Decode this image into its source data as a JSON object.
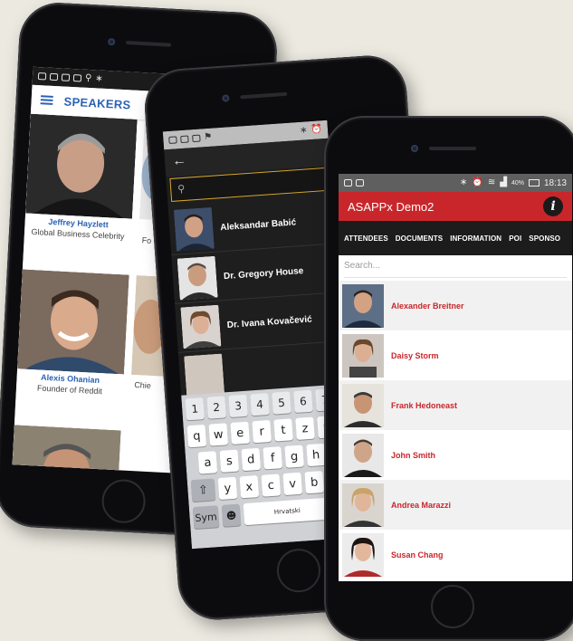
{
  "phone1": {
    "header_title": "SPEAKERS",
    "speakers": [
      {
        "name": "Jeffrey Hayzlett",
        "role": "Global Business Celebrity"
      },
      {
        "name": "",
        "role": "Fo"
      },
      {
        "name": "Alexis Ohanian",
        "role": "Founder of Reddit"
      },
      {
        "name": "",
        "role": "Chie"
      },
      {
        "name": "",
        "role": ""
      }
    ]
  },
  "phone2": {
    "contacts": [
      {
        "name": "Aleksandar Babić"
      },
      {
        "name": "Dr. Gregory House"
      },
      {
        "name": "Dr. Ivana Kovačević"
      }
    ],
    "keyboard": {
      "numbers": [
        "1",
        "2",
        "3",
        "4",
        "5",
        "6",
        "7"
      ],
      "row1": [
        "q",
        "w",
        "e",
        "r",
        "t",
        "z",
        "u"
      ],
      "row2": [
        "a",
        "s",
        "d",
        "f",
        "g",
        "h"
      ],
      "row3": [
        "y",
        "x",
        "c",
        "v",
        "b"
      ],
      "sym_label": "Sym",
      "language_label": "Hrvatski"
    }
  },
  "phone3": {
    "app_title": "ASAPPx Demo2",
    "status": {
      "battery": "40%",
      "time": "18:13"
    },
    "tabs": [
      "ATTENDEES",
      "DOCUMENTS",
      "INFORMATION",
      "POI",
      "SPONSO"
    ],
    "search_placeholder": "Search...",
    "attendees": [
      {
        "name": "Alexander Breitner"
      },
      {
        "name": "Daisy Storm"
      },
      {
        "name": "Frank Hedoneast"
      },
      {
        "name": "John Smith"
      },
      {
        "name": "Andrea Marazzi"
      },
      {
        "name": "Susan Chang"
      }
    ]
  },
  "colors": {
    "speakers_blue": "#2b62b5",
    "app_red": "#c9262b",
    "tab_bar": "#1c1c1c",
    "search_border": "#d8a72c"
  }
}
